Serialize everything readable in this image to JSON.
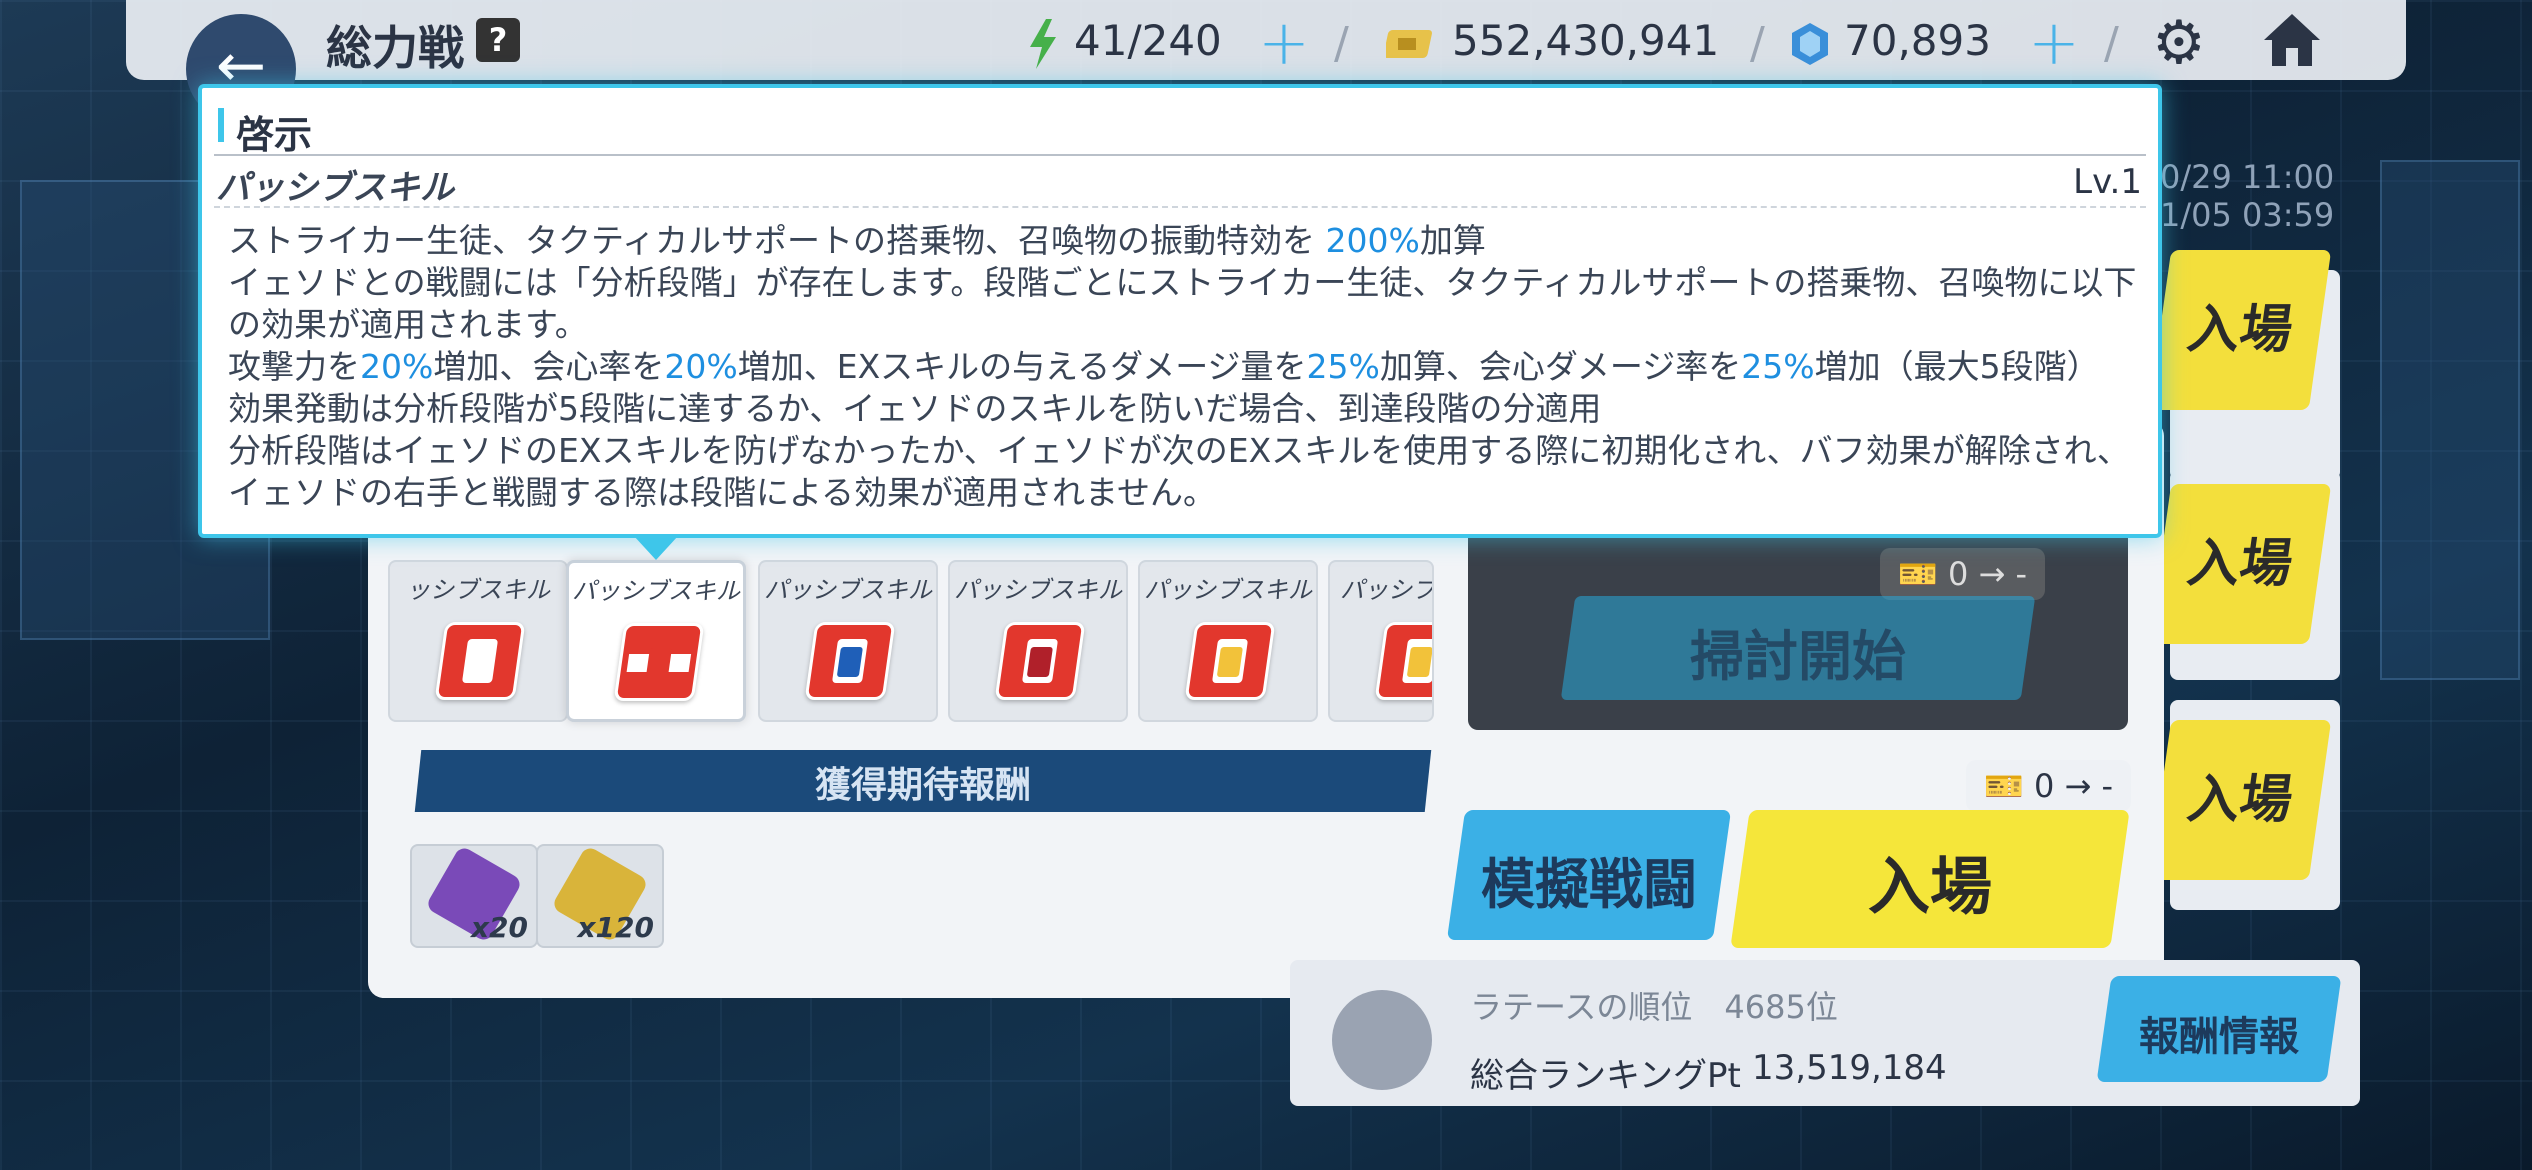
{
  "topbar": {
    "title": "総力戦",
    "help": "?",
    "back_icon": "←",
    "ap": "41/240",
    "credits": "552,430,941",
    "pyroxene": "70,893",
    "plus": "+",
    "sep": "/",
    "gear": "⚙"
  },
  "dates": {
    "start": "0/29 11:00",
    "end": "1/05 03:59"
  },
  "side": {
    "enter": "入場"
  },
  "tooltip": {
    "title": "啓示",
    "subtitle": "パッシブスキル",
    "level": "Lv.1",
    "l1a": "ストライカー生徒、タクティカルサポートの搭乗物、召喚物の振動特効を ",
    "l1b": "200%",
    "l1c": "加算",
    "l2": "イェソドとの戦闘には「分析段階」が存在します。段階ごとにストライカー生徒、タクティカルサポートの搭乗物、召喚物に以下の効果が適用されます。",
    "l3a": "攻撃力を",
    "l3b": "20%",
    "l3c": "増加、会心率を",
    "l3d": "20%",
    "l3e": "増加、EXスキルの与えるダメージ量を",
    "l3f": "25%",
    "l3g": "加算、会心ダメージ率を",
    "l3h": "25%",
    "l3i": "増加（最大5段階）",
    "l4": "効果発動は分析段階が5段階に達するか、イェソドのスキルを防いだ場合、到達段階の分適用",
    "l5": "分析段階はイェソドのEXスキルを防げなかったか、イェソドが次のEXスキルを使用する際に初期化され、バフ効果が解除され、イェソドの右手と戦闘する際は段階による効果が適用されません。"
  },
  "skills": [
    {
      "label": "ッシブスキル",
      "core": "#ffffff"
    },
    {
      "label": "パッシブスキル",
      "core": "#e2372d"
    },
    {
      "label": "パッシブスキル",
      "core": "#1f5fb8"
    },
    {
      "label": "パッシブスキル",
      "core": "#b0202a"
    },
    {
      "label": "パッシブスキル",
      "core": "#f2c23a"
    },
    {
      "label": "パッシブス",
      "core": "#f2c23a"
    }
  ],
  "rewards": {
    "title": "獲得期待報酬",
    "items": [
      {
        "qty": "x20",
        "color": "#7a4ab8"
      },
      {
        "qty": "x120",
        "color": "#d9b43a"
      }
    ]
  },
  "sweep": {
    "label": "掃討開始",
    "ticket": "0 → -"
  },
  "entry": {
    "ticket": "0 → -",
    "simulate": "模擬戦闘",
    "enter": "入場"
  },
  "ranking": {
    "faded": "ラテースの順位　4685位",
    "label": "総合ランキングPt",
    "value": "13,519,184",
    "reward_info": "報酬情報"
  }
}
